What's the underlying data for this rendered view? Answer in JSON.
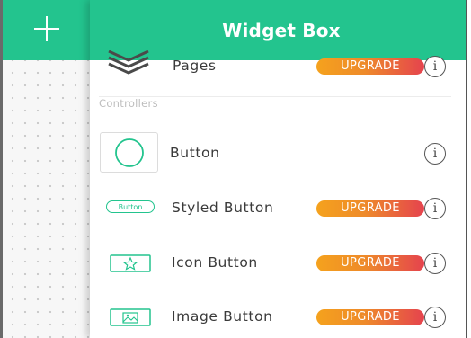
{
  "header": {
    "title": "Widget Box",
    "add_icon": "plus-icon"
  },
  "colors": {
    "header_bg": "#23c48e",
    "upgrade_start": "#f5a21d",
    "upgrade_end": "#e5434e",
    "widget_icon": "#23c48e"
  },
  "widgets_top": [
    {
      "label": "Pages",
      "badge": "UPGRADE",
      "icon": "pages-stack-icon"
    }
  ],
  "section": {
    "label": "Controllers"
  },
  "controllers": [
    {
      "label": "Button",
      "badge": "",
      "icon": "circle-button-icon"
    },
    {
      "label": "Styled Button",
      "badge": "UPGRADE",
      "icon": "styled-button-icon",
      "icon_text": "Button"
    },
    {
      "label": "Icon Button",
      "badge": "UPGRADE",
      "icon": "star-button-icon"
    },
    {
      "label": "Image Button",
      "badge": "UPGRADE",
      "icon": "image-button-icon"
    }
  ]
}
